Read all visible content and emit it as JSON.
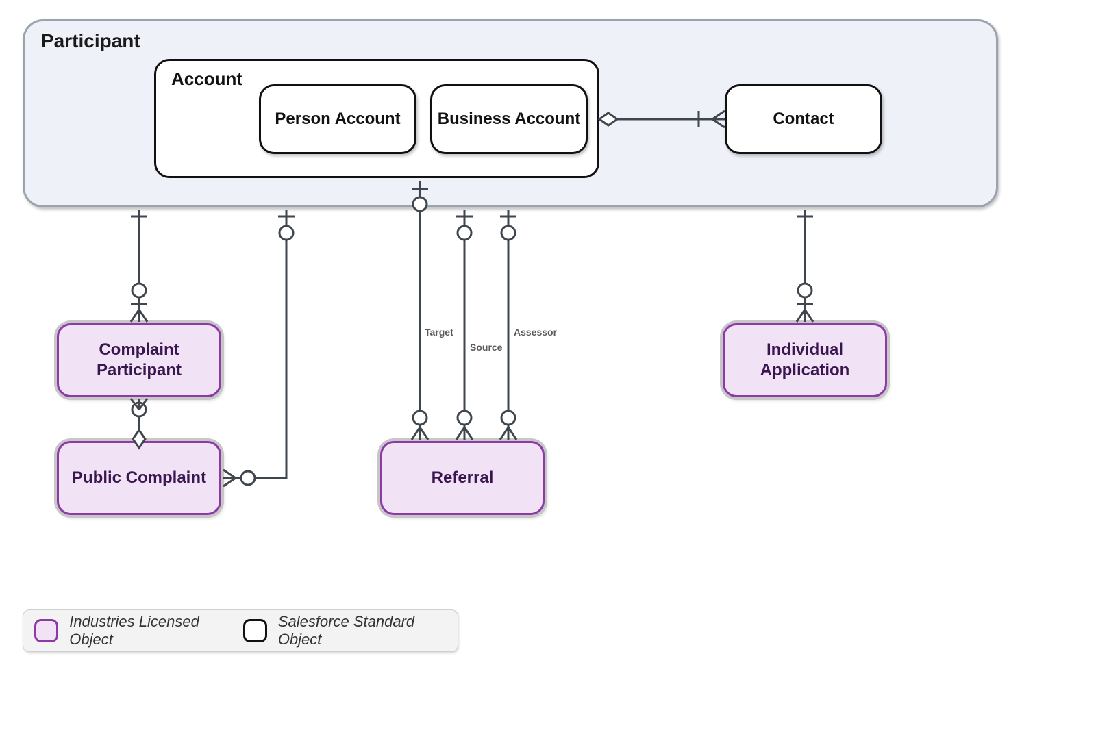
{
  "diagram": {
    "title_container": "Participant",
    "account_container": "Account",
    "entities": {
      "person_account": "Person Account",
      "business_account": "Business Account",
      "contact": "Contact",
      "complaint_participant": "Complaint Participant",
      "public_complaint": "Public Complaint",
      "referral": "Referral",
      "individual_application": "Individual Application"
    },
    "relationships": [
      {
        "from": "Account",
        "to": "Contact",
        "type": "aggregation-one-to-many"
      },
      {
        "from": "Participant",
        "to": "Complaint Participant",
        "type": "one-to-many"
      },
      {
        "from": "Complaint Participant",
        "to": "Public Complaint",
        "type": "aggregation-one-to-many"
      },
      {
        "from": "Participant",
        "to": "Public Complaint",
        "type": "one-to-many"
      },
      {
        "from": "Account",
        "to": "Referral",
        "type": "one-to-many",
        "label": "Target"
      },
      {
        "from": "Participant",
        "to": "Referral",
        "type": "one-to-many",
        "label": "Source"
      },
      {
        "from": "Participant",
        "to": "Referral",
        "type": "one-to-many",
        "label": "Assessor"
      },
      {
        "from": "Participant",
        "to": "Individual Application",
        "type": "one-to-many"
      }
    ]
  },
  "legend": {
    "licensed": "Industries Licensed Object",
    "standard": "Salesforce Standard Object"
  },
  "colors": {
    "licensed_border": "#8c3aa8",
    "licensed_fill": "#f1e2f6",
    "standard_border": "#111111",
    "container_fill": "#eef1f8",
    "connector": "#3f464d"
  }
}
